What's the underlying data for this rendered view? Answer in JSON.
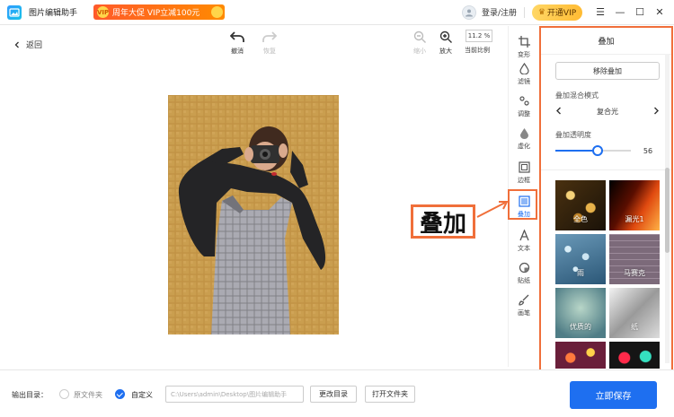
{
  "app": {
    "title": "图片编辑助手"
  },
  "promo": {
    "badge": "VIP",
    "text": "周年大促 VIP立减100元"
  },
  "user": {
    "login_label": "登录/注册",
    "vip_label": "开通VIP"
  },
  "window": {
    "menu": "☰",
    "minimize": "—",
    "maximize": "☐",
    "close": "✕"
  },
  "toolbar": {
    "back_label": "返回",
    "undo_label": "撤消",
    "redo_label": "恢复",
    "zoom_out_label": "缩小",
    "zoom_in_label": "放大",
    "zoom_value": "11.2 %",
    "zoom_label": "当前比例"
  },
  "strip": {
    "items": [
      {
        "label": "变形",
        "icon": "crop-icon"
      },
      {
        "label": "滤镜",
        "icon": "filter-icon"
      },
      {
        "label": "调整",
        "icon": "adjust-icon"
      },
      {
        "label": "虚化",
        "icon": "blur-icon"
      },
      {
        "label": "边框",
        "icon": "border-icon"
      },
      {
        "label": "叠加",
        "icon": "overlay-icon",
        "active": true
      },
      {
        "label": "文本",
        "icon": "text-icon"
      },
      {
        "label": "贴纸",
        "icon": "sticker-icon"
      },
      {
        "label": "画笔",
        "icon": "brush-icon"
      }
    ]
  },
  "panel": {
    "title": "叠加",
    "remove_label": "移除叠加",
    "blend_label": "叠加混合模式",
    "blend_value": "复合光",
    "opacity_label": "叠加透明度",
    "opacity_value": "56",
    "opacity_fraction": 0.56,
    "thumbnails": [
      {
        "name": "全色"
      },
      {
        "name": "漏光1"
      },
      {
        "name": "雨"
      },
      {
        "name": "马赛克"
      },
      {
        "name": "优质的"
      },
      {
        "name": "纸"
      },
      {
        "name": ""
      },
      {
        "name": ""
      }
    ]
  },
  "annotation": {
    "text": "叠加",
    "color": "#f06f3a"
  },
  "bottom": {
    "output_label": "输出目录：",
    "source_folder_label": "原文件夹",
    "custom_label": "自定义",
    "path_value": "C:\\Users\\admin\\Desktop\\图片编辑助手",
    "change_dir_label": "更改目录",
    "open_folder_label": "打开文件夹",
    "save_label": "立即保存"
  },
  "colors": {
    "accent": "#1e6ff0",
    "highlight": "#f06f3a"
  }
}
